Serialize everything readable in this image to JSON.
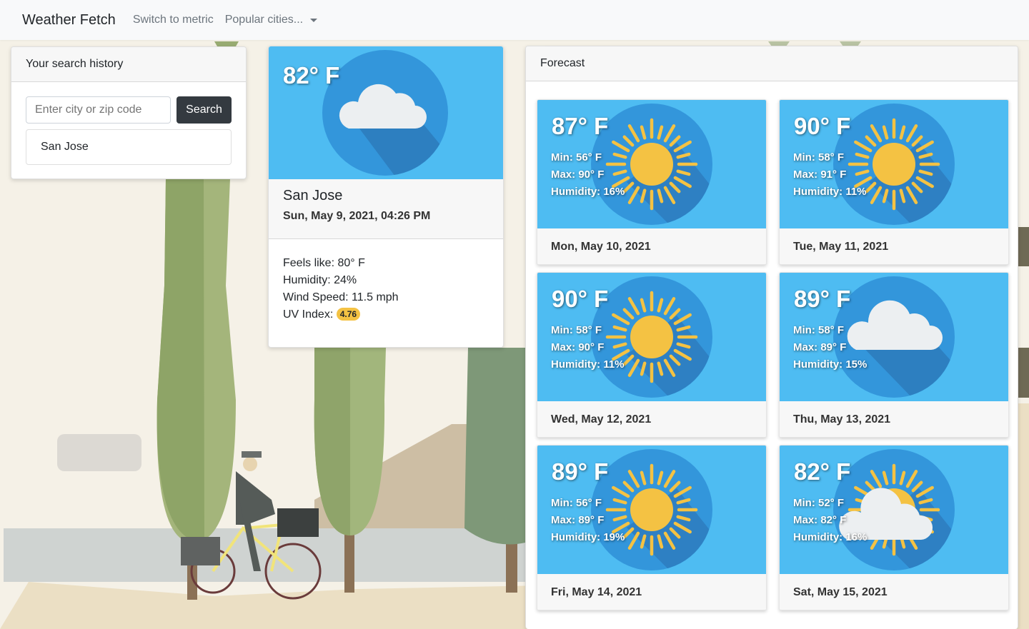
{
  "app": {
    "brand": "Weather Fetch",
    "nav_units": "Switch to metric",
    "nav_cities": "Popular cities..."
  },
  "history": {
    "header": "Your search history",
    "placeholder": "Enter city or zip code",
    "search_label": "Search",
    "items": [
      "San Jose"
    ]
  },
  "current": {
    "temp": "82° F",
    "icon": "cloud-icon",
    "city": "San Jose",
    "datetime": "Sun, May 9, 2021, 04:26 PM",
    "feels_like": "Feels like: 80° F",
    "humidity": "Humidity: 24%",
    "wind": "Wind Speed: 11.5 mph",
    "uv_label": "UV Index:",
    "uv_value": "4.76"
  },
  "forecast": {
    "header": "Forecast",
    "days": [
      {
        "temp": "87° F",
        "min": "Min: 56° F",
        "max": "Max: 90° F",
        "humidity": "Humidity: 16%",
        "date": "Mon, May 10, 2021",
        "icon": "sun-icon"
      },
      {
        "temp": "90° F",
        "min": "Min: 58° F",
        "max": "Max: 91° F",
        "humidity": "Humidity: 11%",
        "date": "Tue, May 11, 2021",
        "icon": "sun-icon"
      },
      {
        "temp": "90° F",
        "min": "Min: 58° F",
        "max": "Max: 90° F",
        "humidity": "Humidity: 11%",
        "date": "Wed, May 12, 2021",
        "icon": "sun-icon"
      },
      {
        "temp": "89° F",
        "min": "Min: 58° F",
        "max": "Max: 89° F",
        "humidity": "Humidity: 15%",
        "date": "Thu, May 13, 2021",
        "icon": "cloud-icon"
      },
      {
        "temp": "89° F",
        "min": "Min: 56° F",
        "max": "Max: 89° F",
        "humidity": "Humidity: 19%",
        "date": "Fri, May 14, 2021",
        "icon": "sun-icon"
      },
      {
        "temp": "82° F",
        "min": "Min: 52° F",
        "max": "Max: 82° F",
        "humidity": "Humidity: 16%",
        "date": "Sat, May 15, 2021",
        "icon": "partly-cloudy-icon"
      }
    ]
  },
  "colors": {
    "sky": "#4ebcf2",
    "disc": "#3396db",
    "sun": "#f4c243",
    "navbar": "#f8f9fa",
    "button": "#343a40"
  }
}
